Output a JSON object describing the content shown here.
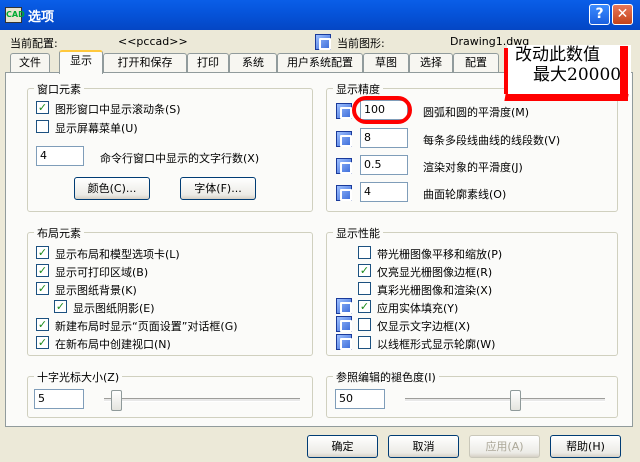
{
  "window": {
    "title": "选项",
    "help": "?",
    "close": "✕",
    "app_icon": "autocad-icon"
  },
  "header": {
    "current_config_label": "当前配置:",
    "current_config_value": "<<pccad>>",
    "current_drawing_label": "当前图形:",
    "current_drawing_value": "Drawing1.dwg"
  },
  "tabs": [
    "文件",
    "显示",
    "打开和保存",
    "打印",
    "系统",
    "用户系统配置",
    "草图",
    "选择",
    "配置"
  ],
  "active_tab": "显示",
  "window_elements": {
    "title": "窗口元素",
    "items": [
      {
        "label": "图形窗口中显示滚动条(S)",
        "checked": "✓"
      },
      {
        "label": "显示屏幕菜单(U)",
        "checked": ""
      }
    ],
    "cmdline_value": "4",
    "cmdline_label": "命令行窗口中显示的文字行数(X)",
    "color_button": "颜色(C)...",
    "font_button": "字体(F)..."
  },
  "display_precision": {
    "title": "显示精度",
    "items": [
      {
        "value": "100",
        "label": "圆弧和圆的平滑度(M)"
      },
      {
        "value": "8",
        "label": "每条多段线曲线的线段数(V)"
      },
      {
        "value": "0.5",
        "label": "渲染对象的平滑度(J)"
      },
      {
        "value": "4",
        "label": "曲面轮廓素线(O)"
      }
    ]
  },
  "layout_elements": {
    "title": "布局元素",
    "items": [
      {
        "label": "显示布局和模型选项卡(L)",
        "checked": "✓"
      },
      {
        "label": "显示可打印区域(B)",
        "checked": "✓"
      },
      {
        "label": "显示图纸背景(K)",
        "checked": "✓"
      },
      {
        "label": "显示图纸阴影(E)",
        "checked": "✓"
      },
      {
        "label": "新建布局时显示“页面设置”对话框(G)",
        "checked": "✓"
      },
      {
        "label": "在新布局中创建视口(N)",
        "checked": "✓"
      }
    ]
  },
  "display_performance": {
    "title": "显示性能",
    "items": [
      {
        "label": "带光栅图像平移和缩放(P)",
        "checked": ""
      },
      {
        "label": "仅亮显光栅图像边框(R)",
        "checked": "✓"
      },
      {
        "label": "真彩光栅图像和渲染(X)",
        "checked": ""
      },
      {
        "label": "应用实体填充(Y)",
        "checked": "✓"
      },
      {
        "label": "仅显示文字边框(X)",
        "checked": ""
      },
      {
        "label": "以线框形式显示轮廓(W)",
        "checked": ""
      }
    ]
  },
  "crosshair": {
    "title": "十字光标大小(Z)",
    "value": "5",
    "level": 5
  },
  "xref_fade": {
    "title": "参照编辑的褪色度(I)",
    "value": "50",
    "level": 50
  },
  "footer": {
    "ok": "确定",
    "cancel": "取消",
    "apply": "应用(A)",
    "help": "帮助(H)"
  },
  "annotation": {
    "line1": "改动此数值",
    "line2": "最大20000"
  }
}
